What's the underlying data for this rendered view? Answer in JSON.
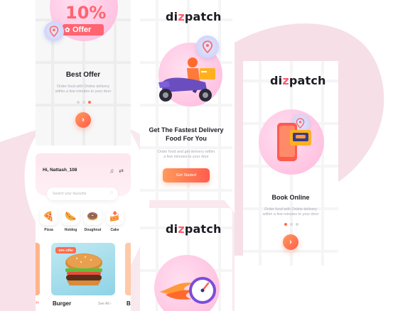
{
  "brand": {
    "logo_prefix": "di",
    "logo_z": "z",
    "logo_suffix": "patch",
    "accent": "#ff5a6e",
    "button_gradient": [
      "#ff9a5b",
      "#ff5e4e"
    ]
  },
  "offer_screen": {
    "percent": "10%",
    "offer_word": "Offer",
    "title": "Best Offer",
    "description_line1": "Order food with Online  delivery",
    "description_line2": "within a few minutes to your door",
    "next_icon": "arrow-right-icon"
  },
  "delivery_screen": {
    "title_line1": "Get The Fastest Delivery",
    "title_line2": "Food For You",
    "description_line1": "Order food and get delivery within",
    "description_line2": "a few minutes to your door",
    "cta_label": "Get Started"
  },
  "book_screen": {
    "title": "Book Online",
    "description_line1": "Order food with Online  delivery",
    "description_line2": "within a few minutes to your door",
    "next_icon": "arrow-right-icon"
  },
  "home_screen": {
    "greeting": "Hi, Nattash_108",
    "search_placeholder": "Search your favourite",
    "categories": [
      {
        "label": "Pizza",
        "icon": "🍕"
      },
      {
        "label": "Hotdog",
        "icon": "🌭"
      },
      {
        "label": "Doughnut",
        "icon": "🍩"
      },
      {
        "label": "Cake",
        "icon": "🍰"
      }
    ],
    "card_badge": "10% Offer",
    "featured_name": "Burger",
    "see_all": "See All",
    "next_card_initial": "B"
  }
}
